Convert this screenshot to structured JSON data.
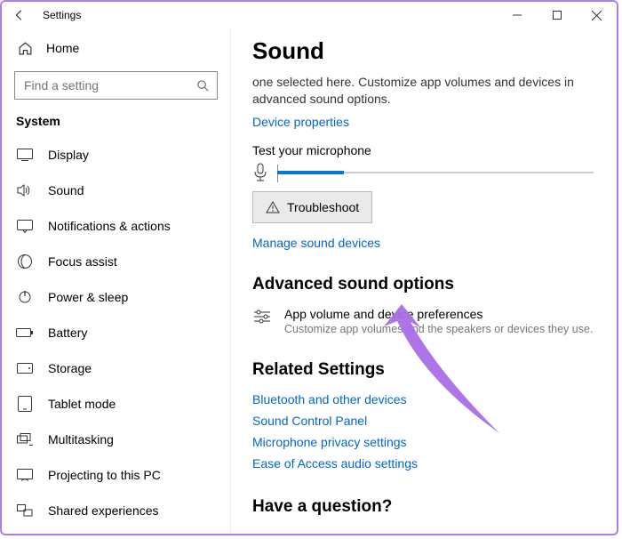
{
  "window": {
    "title": "Settings"
  },
  "sidebar": {
    "home_label": "Home",
    "search_placeholder": "Find a setting",
    "section_label": "System",
    "items": [
      {
        "label": "Display"
      },
      {
        "label": "Sound"
      },
      {
        "label": "Notifications & actions"
      },
      {
        "label": "Focus assist"
      },
      {
        "label": "Power & sleep"
      },
      {
        "label": "Battery"
      },
      {
        "label": "Storage"
      },
      {
        "label": "Tablet mode"
      },
      {
        "label": "Multitasking"
      },
      {
        "label": "Projecting to this PC"
      },
      {
        "label": "Shared experiences"
      }
    ]
  },
  "main": {
    "page_title": "Sound",
    "subtext": "one selected here. Customize app volumes and devices in advanced sound options.",
    "device_properties_link": "Device properties",
    "test_mic_label": "Test your microphone",
    "troubleshoot_label": "Troubleshoot",
    "manage_devices_link": "Manage sound devices",
    "advanced_heading": "Advanced sound options",
    "advanced_item_title": "App volume and device preferences",
    "advanced_item_desc": "Customize app volumes and the speakers or devices they use.",
    "related_heading": "Related Settings",
    "related_links": [
      "Bluetooth and other devices",
      "Sound Control Panel",
      "Microphone privacy settings",
      "Ease of Access audio settings"
    ],
    "question_heading": "Have a question?"
  }
}
